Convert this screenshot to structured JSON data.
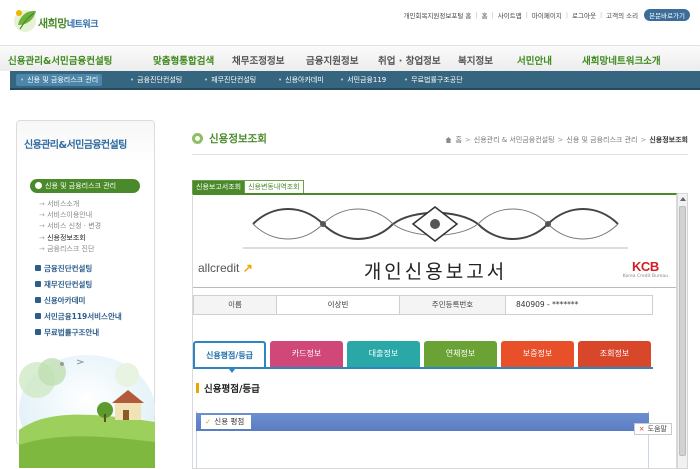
{
  "logo": {
    "main": "새희망",
    "sub": "네트워크"
  },
  "util_links": [
    "개인회복지원정보포털 홈",
    "홈",
    "사이트맵",
    "마이페이지",
    "로그아웃",
    "고객의 소리"
  ],
  "util_button": "본문바로가기",
  "main_nav": [
    "신용관리&서민금융컨설팅",
    "맞춤형통합검색",
    "채무조정정보",
    "금융지원정보",
    "취업 · 창업정보",
    "복지정보",
    "서민안내",
    "새희망네트워크소개"
  ],
  "sub_nav": [
    "신용 및 금융리스크 관리",
    "금융진단컨설팅",
    "재무진단컨설팅",
    "신용아카데미",
    "서민금융119",
    "무료법률구조공단"
  ],
  "left_menu": {
    "title": "신용관리&서민금융컨설팅",
    "active": "신용 및 금융리스크 관리",
    "sub_items": [
      "서비스소개",
      "서비스이용안내",
      "서비스 신청 · 변경",
      "신용정보조회",
      "금융리스크 진단"
    ],
    "main_items": [
      "금융진단컨설팅",
      "재무진단컨설팅",
      "신용아카데미",
      "서민금융119서비스안내",
      "무료법률구조안내"
    ]
  },
  "page": {
    "title": "신용정보조회",
    "breadcrumb": [
      "홈",
      "신용관리 & 서민금융컨설팅",
      "신용 및 금융리스크 관리",
      "신용정보조회"
    ]
  },
  "report_tabs": [
    "신용보고서조회",
    "신용변동내역조회"
  ],
  "report": {
    "brand_left": "allcredit",
    "brand_left_mark": "↗",
    "title": "개인신용보고서",
    "brand_right": "KCB",
    "brand_right_sub": "Korea Credit Bureau",
    "name_label": "이름",
    "name_value": "이상빈",
    "id_label": "주민등록번호",
    "id_value": "840909 - *******"
  },
  "content_tabs": [
    {
      "label": "신용평점/등급",
      "color": "#ffffff"
    },
    {
      "label": "카드정보",
      "color": "#cf4878"
    },
    {
      "label": "대출정보",
      "color": "#2aa7a7"
    },
    {
      "label": "연체정보",
      "color": "#6aa235"
    },
    {
      "label": "보증정보",
      "color": "#e8502a"
    },
    {
      "label": "조회정보",
      "color": "#d9472b"
    }
  ],
  "section": {
    "title": "신용평점/등급",
    "box_label": "신용 평점",
    "help_label": "도움말"
  },
  "colors": {
    "brand_green": "#4a8a2a",
    "nav_blue": "#35657f",
    "accent_blue": "#2e86c1"
  }
}
